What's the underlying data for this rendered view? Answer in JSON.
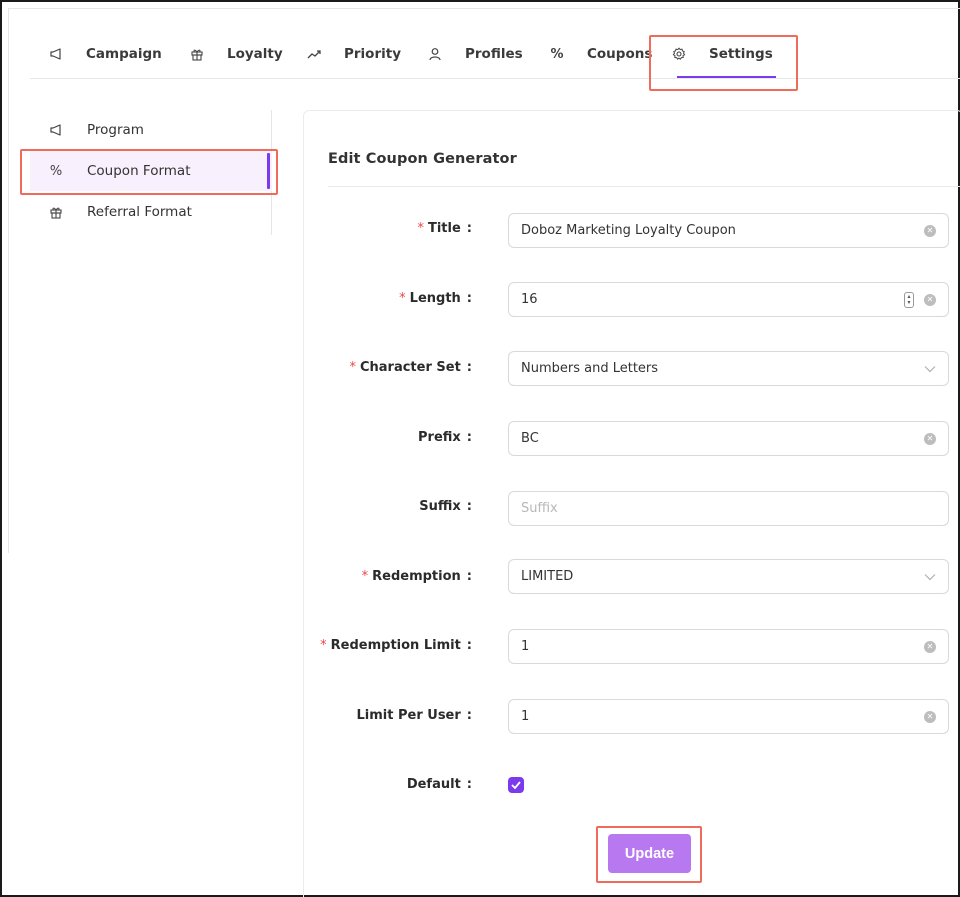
{
  "nav": {
    "tabs": [
      {
        "label": "Campaign",
        "icon": "megaphone-icon"
      },
      {
        "label": "Loyalty",
        "icon": "gift-icon"
      },
      {
        "label": "Priority",
        "icon": "trend-icon"
      },
      {
        "label": "Profiles",
        "icon": "user-icon"
      },
      {
        "label": "Coupons",
        "icon": "percent-icon"
      },
      {
        "label": "Settings",
        "icon": "gear-icon",
        "active": true
      }
    ]
  },
  "sidebar": {
    "items": [
      {
        "label": "Program",
        "icon": "megaphone-icon"
      },
      {
        "label": "Coupon Format",
        "icon": "percent-icon",
        "active": true
      },
      {
        "label": "Referral Format",
        "icon": "gift-icon"
      }
    ]
  },
  "form": {
    "title": "Edit Coupon Generator",
    "fields": {
      "title": {
        "label": "Title",
        "value": "Doboz Marketing Loyalty Coupon",
        "required": true
      },
      "length": {
        "label": "Length",
        "value": "16",
        "required": true
      },
      "charset": {
        "label": "Character Set",
        "value": "Numbers and Letters",
        "required": true
      },
      "prefix": {
        "label": "Prefix",
        "value": "BC",
        "required": false
      },
      "suffix": {
        "label": "Suffix",
        "value": "",
        "placeholder": "Suffix",
        "required": false
      },
      "redemption": {
        "label": "Redemption",
        "value": "LIMITED",
        "required": true
      },
      "redemption_limit": {
        "label": "Redemption Limit",
        "value": "1",
        "required": true
      },
      "limit_per_user": {
        "label": "Limit Per User",
        "value": "1",
        "required": false
      },
      "default": {
        "label": "Default",
        "checked": true
      }
    },
    "required_mark": "*",
    "colon": ":",
    "submit_label": "Update"
  },
  "colors": {
    "accent": "#7c3aed",
    "button": "#b778f0",
    "highlight": "#ef6b5c",
    "required": "#ef4444"
  }
}
